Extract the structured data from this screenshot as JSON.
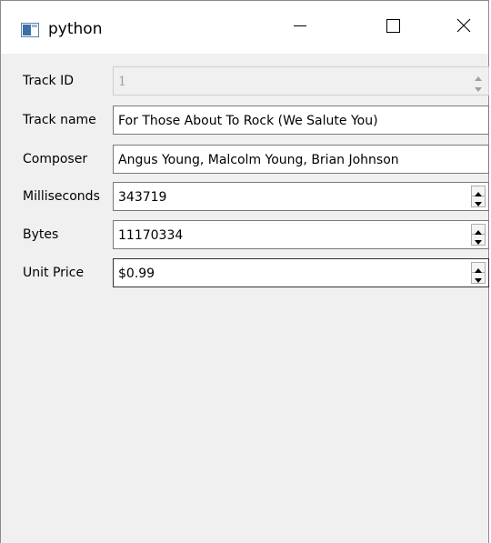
{
  "window": {
    "title": "python",
    "icons": {
      "app": "window-app-icon",
      "minimize": "minimize-icon",
      "maximize": "maximize-icon",
      "close": "close-icon"
    }
  },
  "form": {
    "fields": [
      {
        "label": "Track ID",
        "value": "1",
        "widget": "spinbox",
        "enabled": false
      },
      {
        "label": "Track name",
        "value": "For Those About To Rock (We Salute You)",
        "widget": "line-edit",
        "enabled": true
      },
      {
        "label": "Composer",
        "value": "Angus Young, Malcolm Young, Brian Johnson",
        "widget": "line-edit",
        "enabled": true
      },
      {
        "label": "Milliseconds",
        "value": "343719",
        "widget": "spinbox",
        "enabled": true
      },
      {
        "label": "Bytes",
        "value": "11170334",
        "widget": "spinbox",
        "enabled": true
      },
      {
        "label": "Unit Price",
        "value": "$0.99",
        "widget": "spinbox",
        "enabled": true,
        "focused": true
      }
    ]
  },
  "colors": {
    "titlebar_bg": "#ffffff",
    "client_bg": "#f0f0f0",
    "field_border": "#7a7a7a",
    "disabled_text": "#a0a0a0"
  }
}
